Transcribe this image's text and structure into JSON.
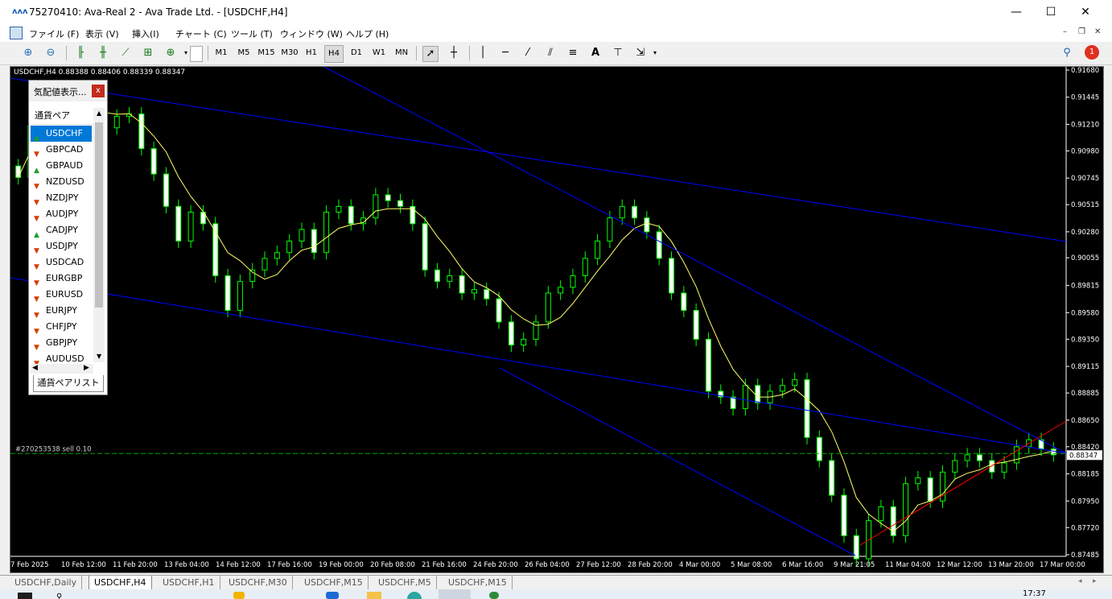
{
  "window": {
    "title": "75270410: Ava-Real 2 - Ava Trade Ltd. - [USDCHF,H4]",
    "controls": [
      "—",
      "☐",
      "✕"
    ]
  },
  "menu": [
    "ファイル (F)",
    "表示 (V)",
    "挿入(I)",
    "チャート (C)",
    "ツール (T)",
    "ウィンドウ (W)",
    "ヘルプ (H)"
  ],
  "toolbar": {
    "timeframes": [
      "M1",
      "M5",
      "M15",
      "M30",
      "H1",
      "H4",
      "D1",
      "W1",
      "MN"
    ],
    "selected_timeframe": "H4",
    "notification_count": "1"
  },
  "chart": {
    "header": "USDCHF,H4  0.88388 0.88406 0.88339 0.88347",
    "order_label": "#270253538 sell 0.10",
    "current_price": "0.88347",
    "price_ticks": [
      "0.91680",
      "0.91445",
      "0.91210",
      "0.90980",
      "0.90745",
      "0.90515",
      "0.90280",
      "0.90055",
      "0.89815",
      "0.89580",
      "0.89350",
      "0.89115",
      "0.88885",
      "0.88650",
      "0.88420",
      "0.88185",
      "0.87950",
      "0.87720",
      "0.87485"
    ],
    "time_ticks": [
      "7 Feb 2025",
      "10 Feb 12:00",
      "11 Feb 20:00",
      "13 Feb 04:00",
      "14 Feb 12:00",
      "17 Feb 16:00",
      "19 Feb 00:00",
      "20 Feb 08:00",
      "21 Feb 16:00",
      "24 Feb 20:00",
      "26 Feb 04:00",
      "27 Feb 12:00",
      "28 Feb 20:00",
      "4 Mar 00:00",
      "5 Mar 08:00",
      "6 Mar 16:00",
      "9 Mar 21:05",
      "11 Mar 04:00",
      "12 Mar 12:00",
      "13 Mar 20:00",
      "17 Mar 00:00"
    ],
    "colors": {
      "bull": "#00ff00",
      "ma": "#ffff66",
      "trendline": "#0000ff",
      "support": "#ff0000",
      "order": "#00aa00"
    }
  },
  "chart_data": {
    "type": "candlestick",
    "symbol": "USDCHF",
    "timeframe": "H4",
    "close_series": [
      0.9075,
      0.912,
      0.915,
      0.9135,
      0.9128,
      0.914,
      0.9135,
      0.9118,
      0.9128,
      0.913,
      0.91,
      0.9078,
      0.905,
      0.902,
      0.9045,
      0.9035,
      0.899,
      0.896,
      0.8985,
      0.8995,
      0.9005,
      0.901,
      0.902,
      0.903,
      0.901,
      0.9045,
      0.905,
      0.9035,
      0.904,
      0.906,
      0.9055,
      0.905,
      0.9035,
      0.8995,
      0.8985,
      0.899,
      0.8975,
      0.8978,
      0.897,
      0.895,
      0.893,
      0.8935,
      0.895,
      0.8975,
      0.898,
      0.899,
      0.9005,
      0.902,
      0.904,
      0.905,
      0.904,
      0.9028,
      0.9005,
      0.8975,
      0.896,
      0.8935,
      0.889,
      0.8885,
      0.8875,
      0.8895,
      0.888,
      0.889,
      0.8895,
      0.89,
      0.885,
      0.883,
      0.88,
      0.8765,
      0.8745,
      0.8778,
      0.879,
      0.8765,
      0.881,
      0.8815,
      0.8795,
      0.882,
      0.883,
      0.8835,
      0.883,
      0.882,
      0.8828,
      0.8842,
      0.8848,
      0.884,
      0.8835
    ],
    "moving_average": true,
    "ylim": [
      0.8748,
      0.9168
    ]
  },
  "market_watch": {
    "title": "気配値表示...",
    "column": "通貨ペア",
    "footer_tab": "通貨ペアリスト",
    "rows": [
      {
        "symbol": "USDCHF",
        "dir": "up"
      },
      {
        "symbol": "GBPCAD",
        "dir": "down"
      },
      {
        "symbol": "GBPAUD",
        "dir": "up"
      },
      {
        "symbol": "NZDUSD",
        "dir": "down"
      },
      {
        "symbol": "NZDJPY",
        "dir": "down"
      },
      {
        "symbol": "AUDJPY",
        "dir": "down"
      },
      {
        "symbol": "CADJPY",
        "dir": "up"
      },
      {
        "symbol": "USDJPY",
        "dir": "down"
      },
      {
        "symbol": "USDCAD",
        "dir": "down"
      },
      {
        "symbol": "EURGBP",
        "dir": "down"
      },
      {
        "symbol": "EURUSD",
        "dir": "down"
      },
      {
        "symbol": "EURJPY",
        "dir": "down"
      },
      {
        "symbol": "CHFJPY",
        "dir": "down"
      },
      {
        "symbol": "GBPJPY",
        "dir": "down"
      },
      {
        "symbol": "AUDUSD",
        "dir": "down"
      }
    ]
  },
  "tabs": [
    "USDCHF,Daily",
    "USDCHF,H4",
    "USDCHF,H1",
    "USDCHF,M30",
    "USDCHF,M15",
    "USDCHF,M5",
    "USDCHF,M15"
  ],
  "active_tab": "USDCHF,H4",
  "taskbar": {
    "time": "17:37"
  }
}
